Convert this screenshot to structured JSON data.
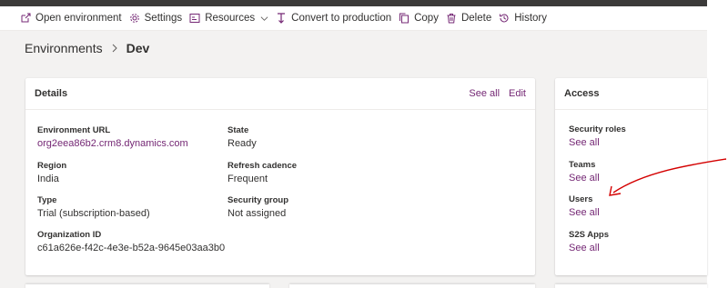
{
  "commands": [
    {
      "id": "open-environment",
      "label": "Open environment",
      "icon": "open-external-icon"
    },
    {
      "id": "settings",
      "label": "Settings",
      "icon": "gear-icon"
    },
    {
      "id": "resources",
      "label": "Resources",
      "icon": "resources-icon",
      "dropdown": true
    },
    {
      "id": "convert",
      "label": "Convert to production",
      "icon": "convert-icon"
    },
    {
      "id": "copy",
      "label": "Copy",
      "icon": "copy-icon"
    },
    {
      "id": "delete",
      "label": "Delete",
      "icon": "trash-icon"
    },
    {
      "id": "history",
      "label": "History",
      "icon": "history-icon"
    }
  ],
  "breadcrumb": {
    "parent": "Environments",
    "current": "Dev"
  },
  "details": {
    "title": "Details",
    "see_all": "See all",
    "edit": "Edit",
    "env_url_label": "Environment URL",
    "env_url_value": "org2eea86b2.crm8.dynamics.com",
    "state_label": "State",
    "state_value": "Ready",
    "region_label": "Region",
    "region_value": "India",
    "refresh_label": "Refresh cadence",
    "refresh_value": "Frequent",
    "type_label": "Type",
    "type_value": "Trial (subscription-based)",
    "security_group_label": "Security group",
    "security_group_value": "Not assigned",
    "org_id_label": "Organization ID",
    "org_id_value": "c61a626e-f42c-4e3e-b52a-9645e03aa3b0"
  },
  "access": {
    "title": "Access",
    "items": [
      {
        "label": "Security roles",
        "link": "See all"
      },
      {
        "label": "Teams",
        "link": "See all"
      },
      {
        "label": "Users",
        "link": "See all"
      },
      {
        "label": "S2S Apps",
        "link": "See all"
      }
    ]
  },
  "colors": {
    "link": "#742774",
    "annotation": "#d40000",
    "topbar": "#3b3a39"
  }
}
